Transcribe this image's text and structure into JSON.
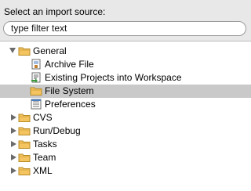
{
  "prompt": "Select an import source:",
  "filter": {
    "value": "type filter text"
  },
  "tree": {
    "general": "General",
    "general_children": [
      "Archive File",
      "Existing Projects into Workspace",
      "File System",
      "Preferences"
    ],
    "folders": [
      "CVS",
      "Run/Debug",
      "Tasks",
      "Team",
      "XML"
    ]
  },
  "colors": {
    "folder_fill": "#f4c460",
    "folder_stroke": "#b88a23",
    "selection": "#c9c9c9",
    "twisty": "#6b6b6b"
  }
}
